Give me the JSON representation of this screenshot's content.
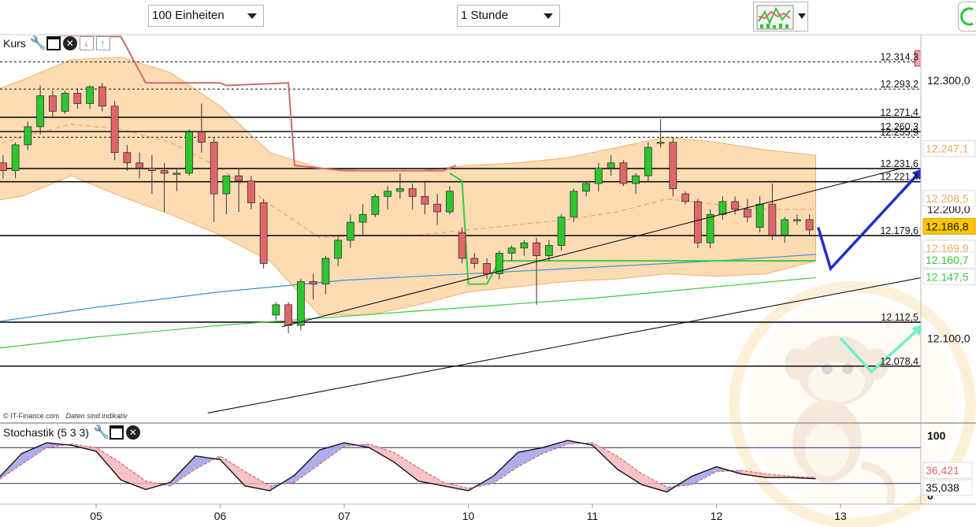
{
  "toolbar": {
    "units_select": "100 Einheiten",
    "interval_select": "1 Stunde",
    "chart_type_icon": "chart-type-icon",
    "refresh_icon": "refresh-icon"
  },
  "main_panel": {
    "title": "Kurs",
    "icons": [
      "wrench-icon",
      "maximize-icon",
      "close-icon",
      "move-down-icon",
      "move-up-icon"
    ],
    "credit": "© IT-Finance.com",
    "credit_note": "Daten sind indikativ"
  },
  "stoch_panel": {
    "title": "Stochastik (5 3 3)",
    "icons": [
      "wrench-icon",
      "maximize-icon",
      "close-icon"
    ]
  },
  "colors": {
    "up": "#2ec62e",
    "down": "#e0666a",
    "band": "#fdd9ac",
    "band_edge": "#f0a860",
    "ma_blue": "#3b8fd6",
    "ma_green": "#39cc39",
    "resistance": "#cc4444",
    "arrow_blue": "#1f2fcc",
    "arrow_teal": "#6ff0c8"
  },
  "chart_data": [
    {
      "type": "candlestick",
      "x_ticks": [
        "05",
        "06",
        "07",
        "10",
        "11",
        "12",
        "13"
      ],
      "y_ticks": [
        12100,
        12200,
        12300
      ],
      "ylim": [
        12045,
        12345
      ],
      "grid": false,
      "price_badges": [
        {
          "value": 12247.1,
          "color": "#f0a860",
          "bg": "#ffffff"
        },
        {
          "value": 12208.5,
          "color": "#f0a860",
          "bg": "#ffffff"
        },
        {
          "value": 12186.8,
          "color": "#111111",
          "bg": "#ffc600"
        },
        {
          "value": 12169.9,
          "color": "#f0a860",
          "bg": "#ffffff"
        },
        {
          "value": 12160.7,
          "color": "#39cc39",
          "bg": "#ffffff"
        },
        {
          "value": 12147.5,
          "color": "#39cc39",
          "bg": "#ffffff"
        }
      ],
      "horizontal_levels": [
        {
          "value": 12314.3,
          "style": "dashed"
        },
        {
          "value": 12293.2,
          "style": "dashed"
        },
        {
          "value": 12271.4,
          "style": "solid"
        },
        {
          "value": 12260.3,
          "style": "solid"
        },
        {
          "value": 12255.9,
          "style": "dashed"
        },
        {
          "value": 12231.6,
          "style": "solid"
        },
        {
          "value": 12221.4,
          "style": "solid"
        },
        {
          "value": 12179.6,
          "style": "solid"
        },
        {
          "value": 12112.5,
          "style": "solid"
        },
        {
          "value": 12078.4,
          "style": "solid"
        }
      ],
      "candles": [
        {
          "t": -0.95,
          "o": 12240,
          "h": 12246,
          "l": 12222,
          "c": 12228
        },
        {
          "t": -0.85,
          "o": 12228,
          "h": 12238,
          "l": 12218,
          "c": 12236
        },
        {
          "t": -0.75,
          "o": 12236,
          "h": 12242,
          "l": 12224,
          "c": 12230
        },
        {
          "t": -0.65,
          "o": 12230,
          "h": 12252,
          "l": 12224,
          "c": 12250
        },
        {
          "t": -0.55,
          "o": 12250,
          "h": 12268,
          "l": 12246,
          "c": 12264
        },
        {
          "t": -0.45,
          "o": 12264,
          "h": 12296,
          "l": 12258,
          "c": 12288
        },
        {
          "t": -0.35,
          "o": 12288,
          "h": 12292,
          "l": 12272,
          "c": 12276
        },
        {
          "t": -0.25,
          "o": 12276,
          "h": 12292,
          "l": 12274,
          "c": 12290
        },
        {
          "t": -0.15,
          "o": 12290,
          "h": 12294,
          "l": 12278,
          "c": 12282
        },
        {
          "t": -0.05,
          "o": 12282,
          "h": 12296,
          "l": 12278,
          "c": 12295
        },
        {
          "t": 0.05,
          "o": 12295,
          "h": 12298,
          "l": 12276,
          "c": 12280
        },
        {
          "t": 0.15,
          "o": 12280,
          "h": 12284,
          "l": 12238,
          "c": 12244
        },
        {
          "t": 0.25,
          "o": 12244,
          "h": 12250,
          "l": 12230,
          "c": 12236
        },
        {
          "t": 0.35,
          "o": 12236,
          "h": 12244,
          "l": 12224,
          "c": 12232
        },
        {
          "t": 0.45,
          "o": 12232,
          "h": 12242,
          "l": 12212,
          "c": 12230
        },
        {
          "t": 0.55,
          "o": 12230,
          "h": 12236,
          "l": 12198,
          "c": 12228
        },
        {
          "t": 0.65,
          "o": 12228,
          "h": 12232,
          "l": 12214,
          "c": 12228
        },
        {
          "t": 0.75,
          "o": 12228,
          "h": 12262,
          "l": 12226,
          "c": 12260
        },
        {
          "t": 0.85,
          "o": 12260,
          "h": 12282,
          "l": 12244,
          "c": 12252
        },
        {
          "t": 0.95,
          "o": 12252,
          "h": 12256,
          "l": 12190,
          "c": 12212
        },
        {
          "t": 1.05,
          "o": 12212,
          "h": 12226,
          "l": 12196,
          "c": 12226
        },
        {
          "t": 1.15,
          "o": 12226,
          "h": 12232,
          "l": 12198,
          "c": 12222
        },
        {
          "t": 1.25,
          "o": 12222,
          "h": 12226,
          "l": 12200,
          "c": 12205
        },
        {
          "t": 1.35,
          "o": 12205,
          "h": 12208,
          "l": 12154,
          "c": 12158
        },
        {
          "t": 1.45,
          "o": 12118,
          "h": 12128,
          "l": 12114,
          "c": 12126
        },
        {
          "t": 1.55,
          "o": 12126,
          "h": 12128,
          "l": 12104,
          "c": 12110
        },
        {
          "t": 1.65,
          "o": 12110,
          "h": 12146,
          "l": 12106,
          "c": 12144
        },
        {
          "t": 1.75,
          "o": 12144,
          "h": 12150,
          "l": 12130,
          "c": 12142
        },
        {
          "t": 1.85,
          "o": 12142,
          "h": 12164,
          "l": 12134,
          "c": 12162
        },
        {
          "t": 1.95,
          "o": 12162,
          "h": 12180,
          "l": 12156,
          "c": 12176
        },
        {
          "t": 2.05,
          "o": 12176,
          "h": 12196,
          "l": 12170,
          "c": 12190
        },
        {
          "t": 2.15,
          "o": 12190,
          "h": 12204,
          "l": 12180,
          "c": 12196
        },
        {
          "t": 2.25,
          "o": 12196,
          "h": 12212,
          "l": 12194,
          "c": 12210
        },
        {
          "t": 2.35,
          "o": 12210,
          "h": 12218,
          "l": 12200,
          "c": 12214
        },
        {
          "t": 2.45,
          "o": 12214,
          "h": 12228,
          "l": 12208,
          "c": 12216
        },
        {
          "t": 2.55,
          "o": 12216,
          "h": 12220,
          "l": 12200,
          "c": 12210
        },
        {
          "t": 2.65,
          "o": 12210,
          "h": 12222,
          "l": 12196,
          "c": 12204
        },
        {
          "t": 2.75,
          "o": 12204,
          "h": 12212,
          "l": 12188,
          "c": 12198
        },
        {
          "t": 2.85,
          "o": 12198,
          "h": 12218,
          "l": 12196,
          "c": 12214
        },
        {
          "t": 2.95,
          "o": 12182,
          "h": 12186,
          "l": 12158,
          "c": 12162
        },
        {
          "t": 3.05,
          "o": 12162,
          "h": 12166,
          "l": 12154,
          "c": 12158
        },
        {
          "t": 3.15,
          "o": 12158,
          "h": 12162,
          "l": 12146,
          "c": 12150
        },
        {
          "t": 3.25,
          "o": 12150,
          "h": 12168,
          "l": 12146,
          "c": 12166
        },
        {
          "t": 3.35,
          "o": 12166,
          "h": 12172,
          "l": 12160,
          "c": 12170
        },
        {
          "t": 3.45,
          "o": 12170,
          "h": 12176,
          "l": 12164,
          "c": 12174
        },
        {
          "t": 3.55,
          "o": 12174,
          "h": 12178,
          "l": 12126,
          "c": 12164
        },
        {
          "t": 3.65,
          "o": 12164,
          "h": 12176,
          "l": 12160,
          "c": 12172
        },
        {
          "t": 3.75,
          "o": 12172,
          "h": 12196,
          "l": 12168,
          "c": 12194
        },
        {
          "t": 3.85,
          "o": 12194,
          "h": 12216,
          "l": 12190,
          "c": 12214
        },
        {
          "t": 3.95,
          "o": 12214,
          "h": 12222,
          "l": 12210,
          "c": 12220
        },
        {
          "t": 4.05,
          "o": 12220,
          "h": 12236,
          "l": 12214,
          "c": 12232
        },
        {
          "t": 4.15,
          "o": 12232,
          "h": 12242,
          "l": 12226,
          "c": 12236
        },
        {
          "t": 4.25,
          "o": 12236,
          "h": 12238,
          "l": 12218,
          "c": 12220
        },
        {
          "t": 4.35,
          "o": 12220,
          "h": 12228,
          "l": 12212,
          "c": 12226
        },
        {
          "t": 4.45,
          "o": 12226,
          "h": 12252,
          "l": 12222,
          "c": 12248
        },
        {
          "t": 4.55,
          "o": 12252,
          "h": 12270,
          "l": 12248,
          "c": 12252
        },
        {
          "t": 4.65,
          "o": 12252,
          "h": 12256,
          "l": 12210,
          "c": 12216
        },
        {
          "t": 4.75,
          "o": 12212,
          "h": 12214,
          "l": 12204,
          "c": 12206
        },
        {
          "t": 4.85,
          "o": 12206,
          "h": 12208,
          "l": 12170,
          "c": 12174
        },
        {
          "t": 4.95,
          "o": 12174,
          "h": 12200,
          "l": 12170,
          "c": 12196
        },
        {
          "t": 5.05,
          "o": 12196,
          "h": 12210,
          "l": 12192,
          "c": 12206
        },
        {
          "t": 5.15,
          "o": 12206,
          "h": 12210,
          "l": 12196,
          "c": 12200
        },
        {
          "t": 5.25,
          "o": 12200,
          "h": 12208,
          "l": 12190,
          "c": 12194
        },
        {
          "t": 5.35,
          "o": 12186,
          "h": 12210,
          "l": 12182,
          "c": 12204
        },
        {
          "t": 5.45,
          "o": 12204,
          "h": 12220,
          "l": 12176,
          "c": 12180
        },
        {
          "t": 5.55,
          "o": 12180,
          "h": 12194,
          "l": 12174,
          "c": 12192
        },
        {
          "t": 5.65,
          "o": 12192,
          "h": 12196,
          "l": 12188,
          "c": 12192
        },
        {
          "t": 5.75,
          "o": 12192,
          "h": 12196,
          "l": 12180,
          "c": 12184
        }
      ],
      "bollinger": {
        "t": [
          -1.0,
          -0.6,
          -0.2,
          0.2,
          0.6,
          1.0,
          1.4,
          1.8,
          2.2,
          2.6,
          3.0,
          3.4,
          3.8,
          4.2,
          4.6,
          5.0,
          5.4,
          5.8
        ],
        "upper": [
          12286,
          12300,
          12316,
          12318,
          12306,
          12280,
          12244,
          12232,
          12230,
          12230,
          12234,
          12236,
          12240,
          12248,
          12256,
          12252,
          12246,
          12242
        ],
        "lower": [
          12204,
          12210,
          12226,
          12210,
          12196,
          12180,
          12160,
          12118,
          12118,
          12126,
          12136,
          12140,
          12144,
          12146,
          12150,
          12148,
          12150,
          12160
        ],
        "middle": [
          12244,
          12256,
          12266,
          12262,
          12252,
          12232,
          12204,
          12178,
          12180,
          12180,
          12184,
          12188,
          12192,
          12198,
          12208,
          12204,
          12200,
          12200
        ]
      },
      "moving_averages": [
        {
          "color": "#3b8fd6",
          "t": [
            -1.0,
            0.0,
            1.0,
            2.0,
            3.0,
            4.0,
            5.0,
            5.8
          ],
          "v": [
            12110,
            12124,
            12136,
            12145,
            12150,
            12155,
            12160,
            12165
          ]
        },
        {
          "color": "#39cc39",
          "t": [
            -1.0,
            0.0,
            1.0,
            2.0,
            3.0,
            4.0,
            5.0,
            5.8
          ],
          "v": [
            12090,
            12101,
            12110,
            12117,
            12124,
            12131,
            12140,
            12147
          ]
        }
      ],
      "stepped_lines": [
        {
          "color": "#cc6b6b",
          "t": [
            -0.3,
            0.2,
            0.4,
            1.0,
            1.05,
            1.55,
            1.6,
            2.0,
            2.8,
            2.9
          ],
          "v": [
            12334,
            12334,
            12298,
            12298,
            12296,
            12298,
            12234,
            12230,
            12230,
            12234
          ]
        },
        {
          "color": "#39cc39",
          "t": [
            2.85,
            2.95,
            3.0,
            3.15,
            3.25,
            5.8
          ],
          "v": [
            12228,
            12222,
            12142,
            12142,
            12160,
            12160
          ]
        }
      ],
      "trend_lines": [
        {
          "t1": 1.5,
          "v1": 12109,
          "t2": 6.5,
          "v2": 12232
        },
        {
          "t1": 0.9,
          "v1": 12042,
          "t2": 7.2,
          "v2": 12157
        }
      ],
      "annotations": [
        {
          "kind": "polyline-arrow",
          "color": "#1f2fcc",
          "points": [
            [
              5.82,
              12186
            ],
            [
              5.92,
              12154
            ],
            [
              6.65,
              12230
            ]
          ]
        },
        {
          "kind": "polyline-arrow",
          "color": "#6ff0c8",
          "points": [
            [
              6.0,
              12100
            ],
            [
              6.25,
              12074
            ],
            [
              6.65,
              12109
            ]
          ]
        },
        {
          "kind": "polyline-arrow",
          "color": "#6ff0c8",
          "points": [
            [
              6.7,
              12290
            ],
            [
              7.0,
              12316
            ],
            [
              7.2,
              12294
            ]
          ]
        },
        {
          "kind": "box",
          "color": "#f4a8a8",
          "t1": 6.6,
          "t2": 7.15,
          "v1": 12311,
          "v2": 12323
        }
      ]
    },
    {
      "type": "line",
      "ylim": [
        0,
        100
      ],
      "y_ticks": [
        0,
        100
      ],
      "levels": [
        20,
        80
      ],
      "value_badges": [
        {
          "value": 36.421,
          "color": "#e0666a"
        },
        {
          "value": 35.038,
          "color": "#111111"
        }
      ],
      "series": [
        {
          "color": "#111111",
          "t": [
            -1.0,
            -0.8,
            -0.6,
            -0.4,
            -0.2,
            0.0,
            0.2,
            0.4,
            0.6,
            0.8,
            1.0,
            1.2,
            1.4,
            1.6,
            1.8,
            2.0,
            2.2,
            2.4,
            2.6,
            2.8,
            3.0,
            3.2,
            3.4,
            3.6,
            3.8,
            4.0,
            4.2,
            4.4,
            4.6,
            4.8,
            5.0,
            5.2,
            5.4,
            5.6,
            5.8
          ],
          "v": [
            22,
            26,
            70,
            88,
            84,
            74,
            26,
            10,
            22,
            66,
            60,
            16,
            8,
            34,
            76,
            88,
            80,
            56,
            24,
            16,
            8,
            32,
            72,
            80,
            92,
            84,
            44,
            18,
            6,
            32,
            48,
            36,
            30,
            30,
            28
          ]
        },
        {
          "color": "#e0666a",
          "t": [
            -1.0,
            -0.8,
            -0.6,
            -0.4,
            -0.2,
            0.0,
            0.2,
            0.4,
            0.6,
            0.8,
            1.0,
            1.2,
            1.4,
            1.6,
            1.8,
            2.0,
            2.2,
            2.4,
            2.6,
            2.8,
            3.0,
            3.2,
            3.4,
            3.6,
            3.8,
            4.0,
            4.2,
            4.4,
            4.6,
            4.8,
            5.0,
            5.2,
            5.4,
            5.6,
            5.8
          ],
          "v": [
            20,
            24,
            52,
            80,
            86,
            80,
            54,
            24,
            16,
            44,
            66,
            40,
            16,
            22,
            52,
            82,
            86,
            72,
            46,
            22,
            12,
            20,
            48,
            70,
            86,
            88,
            66,
            36,
            14,
            18,
            40,
            42,
            36,
            32,
            30
          ]
        }
      ]
    }
  ]
}
